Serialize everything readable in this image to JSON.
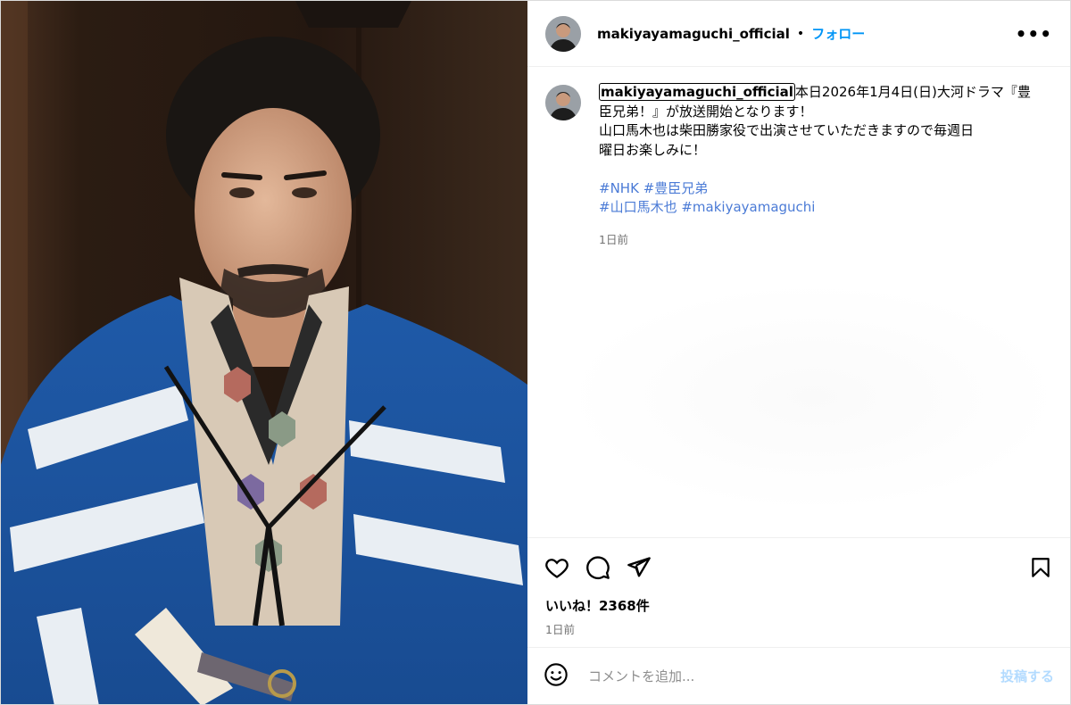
{
  "post": {
    "username": "makiyayamaguchi_official",
    "separator": "•",
    "follow_label": "フォロー",
    "more_label": "•••",
    "caption_lines": [
      "本日2026年1月4日(日)大河ドラマ『豊",
      "臣兄弟！』が放送開始となります！",
      "山口馬木也は柴田勝家役で出演させていただきますので毎週日",
      "曜日お楽しみに！"
    ],
    "hashtags_line1": [
      "#NHK",
      "#豊臣兄弟"
    ],
    "hashtags_line2": [
      "#山口馬木也",
      "#makiyayamaguchi"
    ],
    "caption_time": "1日前",
    "likes": "いいね！2368件",
    "post_time": "1日前"
  },
  "comment_box": {
    "placeholder": "コメントを追加...",
    "post_label": "投稿する"
  },
  "icons": {
    "like": "heart-icon",
    "comment": "comment-bubble-icon",
    "share": "paper-plane-icon",
    "save": "bookmark-icon",
    "emoji": "emoji-smile-icon",
    "more": "more-options-icon"
  },
  "colors": {
    "link": "#0095f6",
    "hashtag": "#4b7bd6",
    "muted": "#737373",
    "post_disabled": "#b3dbff"
  }
}
